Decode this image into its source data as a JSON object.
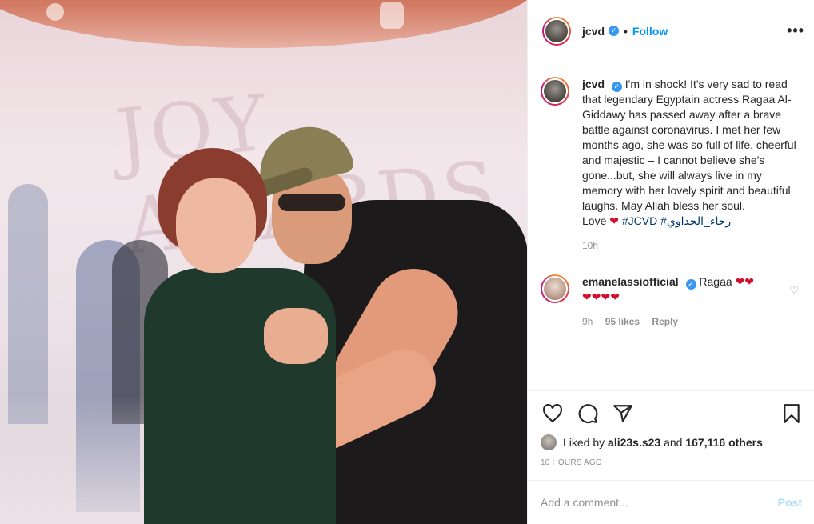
{
  "post": {
    "author": "jcvd",
    "follow_label": "Follow",
    "separator": "•",
    "more_label": "•••",
    "caption_text": "I'm in shock! It's very sad to read that legendary Egyptain actress Ragaa Al-Giddawy has passed away after a brave battle against coronavirus. I met her few months ago, she was so full of life, cheerful and majestic – I cannot believe she's gone...but, she will always live in my memory with her lovely spirit and beautiful laughs. May Allah bless her soul.",
    "caption_love": "Love",
    "caption_heart": "❤",
    "hashtag1": "#JCVD",
    "hashtag2": "#رجاء_الجداوي",
    "caption_age": "10h"
  },
  "comment": {
    "author": "emanelassiofficial",
    "text": "Ragaa",
    "hearts_inline": "❤❤",
    "hearts_line2": "❤❤❤❤",
    "age": "9h",
    "likes": "95 likes",
    "reply": "Reply"
  },
  "actions": {
    "liked_by_prefix": "Liked by",
    "liked_by_user": "ali23s.s23",
    "liked_by_and": "and",
    "liked_by_others": "167,116 others",
    "timestamp": "10 HOURS AGO"
  },
  "composer": {
    "placeholder": "Add a comment...",
    "post_label": "Post"
  },
  "icons": {
    "like": "heart-icon",
    "comment": "comment-icon",
    "share": "share-icon",
    "save": "bookmark-icon",
    "verified": "verified-badge-icon"
  },
  "colors": {
    "link_blue": "#0095f6",
    "verified_blue": "#3897f0",
    "heart_red": "#d1102f",
    "muted": "#8e8e8e"
  }
}
